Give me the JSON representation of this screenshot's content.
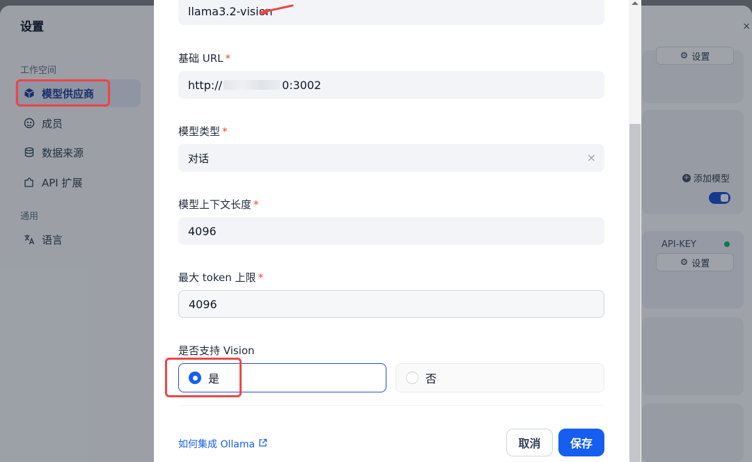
{
  "sidebar": {
    "title": "设置",
    "group_workspace": "工作空间",
    "group_general": "通用",
    "items": [
      {
        "label": "模型供应商",
        "icon": "cube-icon",
        "active": true
      },
      {
        "label": "成员",
        "icon": "members-icon"
      },
      {
        "label": "数据来源",
        "icon": "database-icon"
      },
      {
        "label": "API 扩展",
        "icon": "puzzle-icon"
      },
      {
        "label": "语言",
        "icon": "translate-icon"
      }
    ]
  },
  "background": {
    "settings_button": "设置",
    "add_model": "添加模型",
    "api_key_label": "API-KEY",
    "close_icon": "×"
  },
  "form": {
    "model_name_value": "llama3.2-vision",
    "base_url_label": "基础 URL",
    "base_url_prefix": "http://",
    "base_url_suffix": "0:3002",
    "model_type_label": "模型类型",
    "model_type_value": "对话",
    "context_length_label": "模型上下文长度",
    "context_length_value": "4096",
    "max_token_label": "最大 token 上限",
    "max_token_value": "4096",
    "vision_label": "是否支持 Vision",
    "vision_yes": "是",
    "vision_no": "否",
    "required_mark": "*",
    "clear_icon": "×"
  },
  "footer": {
    "help_link": "如何集成 Ollama",
    "cancel": "取消",
    "save": "保存"
  },
  "colors": {
    "primary": "#155eef",
    "required": "#f04438",
    "annotation": "#ef4444"
  }
}
